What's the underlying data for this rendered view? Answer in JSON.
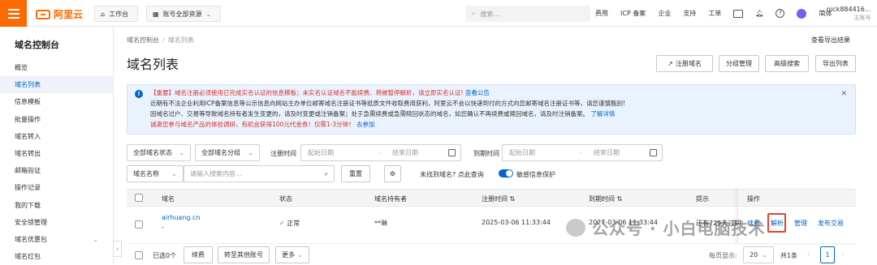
{
  "topbar": {
    "logo_text": "阿里云",
    "workbench": "工作台",
    "resource_scope": "账号全部资源",
    "search_placeholder": "搜索...",
    "links": [
      "费用",
      "ICP 备案",
      "企业",
      "支持",
      "工单"
    ],
    "language": "简体",
    "account_name": "nick884416...",
    "account_role": "主账号"
  },
  "sidebar": {
    "title": "域名控制台",
    "items": [
      "概览",
      "域名列表",
      "信息模板",
      "批量操作",
      "域名转入",
      "域名转出",
      "邮箱验证",
      "操作记录",
      "我的下载",
      "安全锁管理",
      "域名优惠包",
      "域名红包"
    ],
    "active_index": 1
  },
  "breadcrumb": {
    "root": "域名控制台",
    "current": "域名列表"
  },
  "export_results": "查看导出结果",
  "page_title": "域名列表",
  "actions": {
    "register": "注册域名",
    "group": "分组管理",
    "advanced": "高级搜索",
    "export": "导出列表"
  },
  "notice": {
    "line1_red": "【重要】域名注册必须使用已完成实名认证的信息模板；未实名认证域名不能续费、将被暂停解析，请立即实名认证!",
    "line1_link": "查看公告",
    "line2": "近期有不法企业利用ICP备案信息等公示信息向网站主办单位邮寄域名注册证书等纸质文件收取费用获利，阿里云不会以快递到付的方式向您邮寄域名注册证书等，请您谨慎甄别!",
    "line3": "因域名过户、交易等导致域名持有者发生变更的，请及时变更或注销备案；处于急需续费或急需赎回状态的域名，如您确认不再续费或赎回域名，请及时注销备案。",
    "line3_link": "了解详情",
    "line4_red": "诚邀您参与域名产品的体验调研，有机会获得100元代金券！仅需1-3分钟！",
    "line4_link": "去参加"
  },
  "filters": {
    "status": "全部域名状态",
    "group": "全部域名分组",
    "reg_label": "注册时间",
    "expire_label": "到期时间",
    "start_date": "起始日期",
    "end_date": "结束日期",
    "field": "域名名称",
    "search_placeholder": "请输入搜索内容...",
    "reset": "重置",
    "not_found": "未找到域名? 点此查询",
    "privacy": "敏感信息保护"
  },
  "table": {
    "headers": {
      "domain": "域名",
      "status": "状态",
      "holder": "域名持有者",
      "reg": "注册时间",
      "expire": "到期时间",
      "tip": "提示",
      "ops": "操作"
    },
    "row": {
      "domain": "airhuang.cn",
      "domain_sub": "-",
      "status": "正常",
      "holder": "**琳",
      "reg": "2025-03-06 11:33:44",
      "expire": "2027-03-06 11:33:44",
      "tip": "还有729天过期",
      "ops": [
        "续费",
        "解析",
        "管理",
        "发布交易"
      ]
    }
  },
  "footer": {
    "selected": "已选0个",
    "renew": "续费",
    "transfer": "转至其他账号",
    "more": "更多",
    "page_size_label": "每页显示:",
    "page_size": "20",
    "total": "共1条",
    "page": "1"
  },
  "watermark": "公众号 · 小白电脑技术"
}
